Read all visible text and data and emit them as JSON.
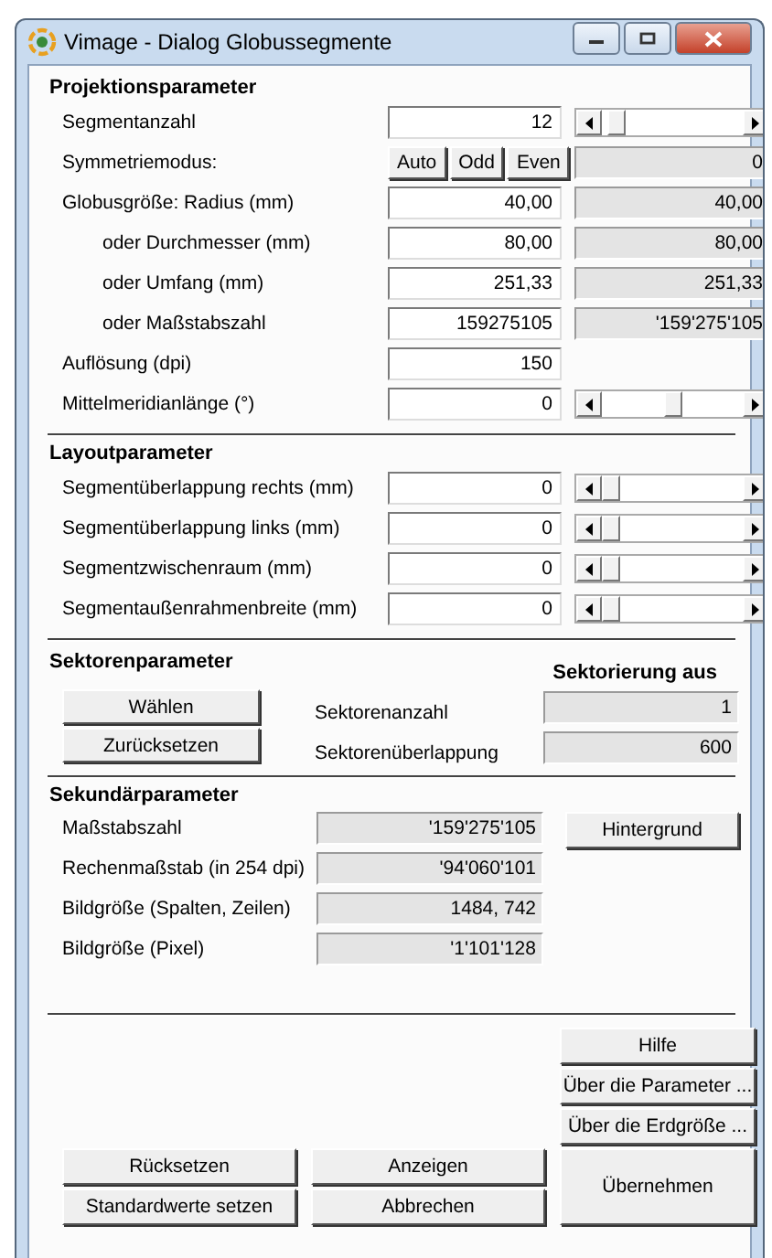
{
  "window": {
    "title": "Vimage - Dialog Globussegmente"
  },
  "projection": {
    "heading": "Projektionsparameter",
    "rows": [
      {
        "kind": "slider",
        "label": "Segmentanzahl",
        "indented": false,
        "value": "12",
        "level": 0.05
      },
      {
        "kind": "buttons",
        "label": "Symmetriemodus:",
        "indented": false,
        "buttons": [
          "Auto",
          "Odd",
          "Even"
        ],
        "mirror": "0"
      },
      {
        "kind": "mirror",
        "label": "Globusgröße: Radius (mm)",
        "indented": false,
        "value": "40,00",
        "mirror": "40,00"
      },
      {
        "kind": "mirror",
        "label": "oder Durchmesser (mm)",
        "indented": true,
        "value": "80,00",
        "mirror": "80,00"
      },
      {
        "kind": "mirror",
        "label": "oder Umfang (mm)",
        "indented": true,
        "value": "251,33",
        "mirror": "251,33"
      },
      {
        "kind": "mirror",
        "label": "oder Maßstabszahl",
        "indented": true,
        "value": "159275105",
        "mirror": "'159'275'105"
      },
      {
        "kind": "plain",
        "label": "Auflösung (dpi)",
        "indented": false,
        "value": "150"
      },
      {
        "kind": "slider",
        "label": "Mittelmeridianlänge (°)",
        "indented": false,
        "value": "0",
        "level": 0.5
      }
    ]
  },
  "layout": {
    "heading": "Layoutparameter",
    "rows": [
      {
        "kind": "slider",
        "label": "Segmentüberlappung rechts (mm)",
        "indented": false,
        "value": "0",
        "level": 0
      },
      {
        "kind": "slider",
        "label": "Segmentüberlappung links (mm)",
        "indented": false,
        "value": "0",
        "level": 0
      },
      {
        "kind": "slider",
        "label": "Segmentzwischenraum (mm)",
        "indented": false,
        "value": "0",
        "level": 0
      },
      {
        "kind": "slider",
        "label": "Segmentaußenrahmenbreite (mm)",
        "indented": false,
        "value": "0",
        "level": 0
      }
    ]
  },
  "sectors": {
    "heading": "Sektorenparameter",
    "status": "Sektorierung aus",
    "buttons": [
      "Wählen",
      "Zurücksetzen"
    ],
    "fields": [
      {
        "label": "Sektorenanzahl",
        "value": "1"
      },
      {
        "label": "Sektorenüberlappung",
        "value": "600"
      }
    ]
  },
  "secondary": {
    "heading": "Sekundärparameter",
    "side_button": "Hintergrund",
    "fields": [
      {
        "label": "Maßstabszahl",
        "value": "'159'275'105"
      },
      {
        "label": "Rechenmaßstab (in 254 dpi)",
        "value": "'94'060'101"
      },
      {
        "label": "Bildgröße (Spalten, Zeilen)",
        "value": "1484, 742"
      },
      {
        "label": "Bildgröße (Pixel)",
        "value": "'1'101'128"
      }
    ]
  },
  "footer": {
    "side_buttons": [
      "Hilfe",
      "Über die Parameter ...",
      "Über die Erdgröße ..."
    ],
    "left_buttons": [
      "Rücksetzen",
      "Standardwerte setzen"
    ],
    "middle_buttons": [
      "Anzeigen",
      "Abbrechen"
    ],
    "apply_button": "Übernehmen"
  }
}
